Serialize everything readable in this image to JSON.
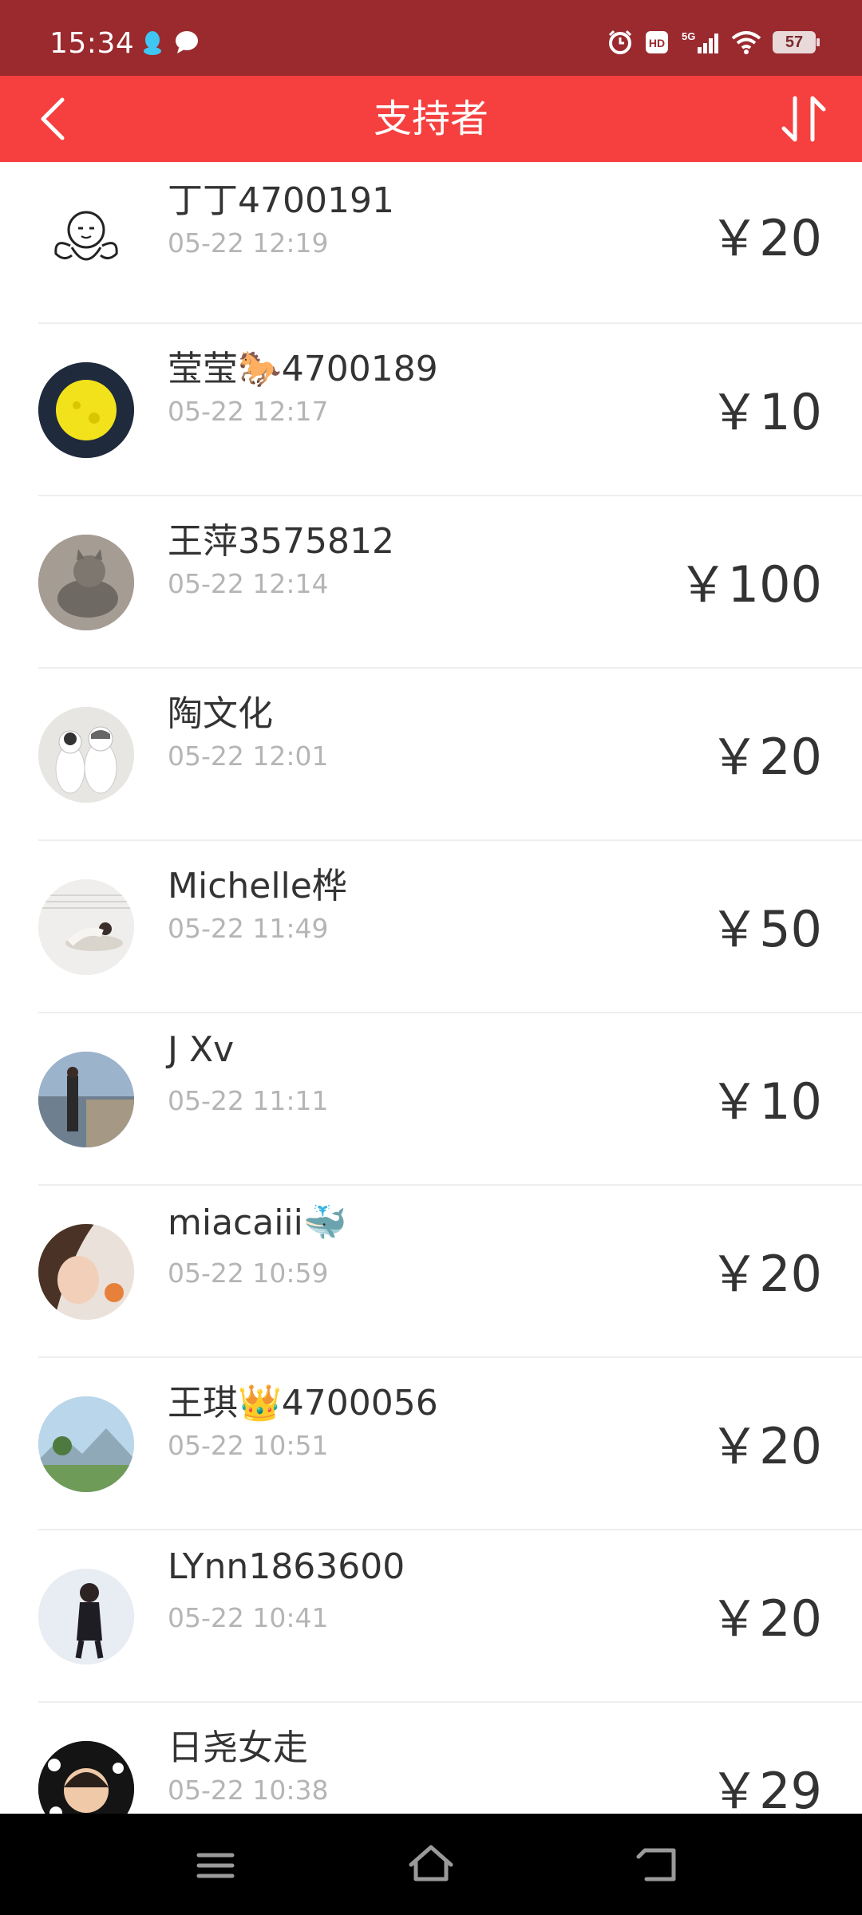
{
  "status_bar": {
    "time": "15:34",
    "battery": "57",
    "network": "5G",
    "hd": "HD"
  },
  "header": {
    "title": "支持者"
  },
  "supporters": [
    {
      "name": "丁丁4700191",
      "time": "05-22 12:19",
      "amount": "￥20"
    },
    {
      "name": "莹莹🐎4700189",
      "time": "05-22 12:17",
      "amount": "￥10"
    },
    {
      "name": "王萍3575812",
      "time": "05-22 12:14",
      "amount": "￥100"
    },
    {
      "name": "陶文化",
      "time": "05-22 12:01",
      "amount": "￥20"
    },
    {
      "name": "Michelle桦",
      "time": "05-22 11:49",
      "amount": "￥50"
    },
    {
      "name": "J Xv",
      "time": "05-22 11:11",
      "amount": "￥10"
    },
    {
      "name": "miacaiii🐳",
      "time": "05-22 10:59",
      "amount": "￥20"
    },
    {
      "name": "王琪👑4700056",
      "time": "05-22 10:51",
      "amount": "￥20"
    },
    {
      "name": "LYnn1863600",
      "time": "05-22 10:41",
      "amount": "￥20"
    },
    {
      "name": "日尧女走",
      "time": "05-22 10:38",
      "amount": "￥29"
    }
  ],
  "colors": {
    "status_bar": "#9a2a2e",
    "header": "#f5403f",
    "name_text": "#333333",
    "time_text": "#b5b5b5"
  }
}
